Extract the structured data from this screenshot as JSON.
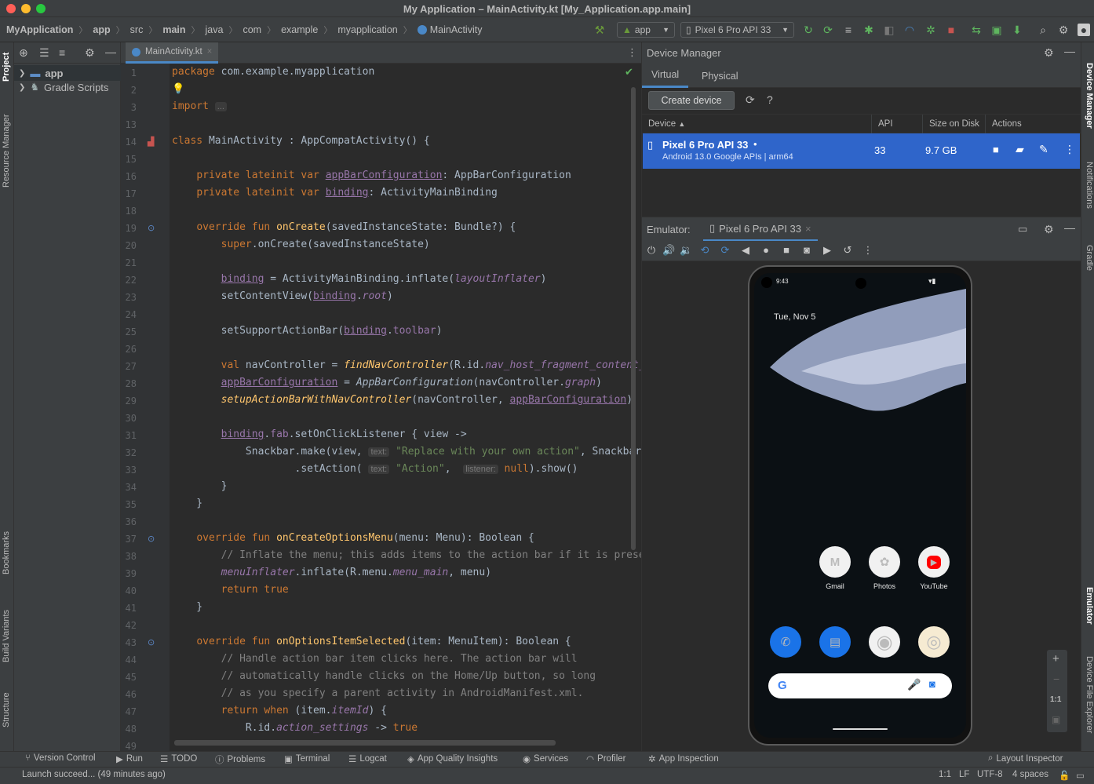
{
  "window": {
    "title": "My Application – MainActivity.kt [My_Application.app.main]"
  },
  "breadcrumb": [
    "MyApplication",
    "app",
    "src",
    "main",
    "java",
    "com",
    "example",
    "myapplication",
    "MainActivity"
  ],
  "toolbar": {
    "run_config": "app",
    "device": "Pixel 6 Pro API 33"
  },
  "left_strip": {
    "project": "Project",
    "resource_manager": "Resource Manager",
    "bookmarks": "Bookmarks",
    "build_variants": "Build Variants",
    "structure": "Structure"
  },
  "project_tree": [
    {
      "label": "app"
    },
    {
      "label": "Gradle Scripts"
    }
  ],
  "editor": {
    "tab": "MainActivity.kt",
    "line_numbers": [
      "1",
      "2",
      "3",
      "13",
      "14",
      "15",
      "16",
      "17",
      "18",
      "19",
      "20",
      "21",
      "22",
      "23",
      "24",
      "25",
      "26",
      "27",
      "28",
      "29",
      "30",
      "31",
      "32",
      "33",
      "34",
      "35",
      "36",
      "37",
      "38",
      "39",
      "40",
      "41",
      "42",
      "43",
      "44",
      "45",
      "46",
      "47",
      "48",
      "49"
    ]
  },
  "device_manager": {
    "title": "Device Manager",
    "tabs": [
      "Virtual",
      "Physical"
    ],
    "create_button": "Create device",
    "help": "?",
    "columns": [
      "Device",
      "API",
      "Size on Disk",
      "Actions"
    ],
    "device": {
      "name": "Pixel 6 Pro API 33",
      "dot": "•",
      "subtitle": "Android 13.0 Google APIs | arm64",
      "api": "33",
      "size": "9.7 GB"
    }
  },
  "emulator": {
    "label": "Emulator:",
    "tab": "Pixel 6 Pro API 33",
    "phone": {
      "time": "9:43",
      "date": "Tue, Nov 5",
      "row1": [
        {
          "name": "Gmail",
          "glyph": "M",
          "color": "#d93025"
        },
        {
          "name": "Photos",
          "glyph": "✿",
          "color": "#fbbc04"
        },
        {
          "name": "YouTube",
          "glyph": "▶",
          "color": "#ffffff"
        }
      ],
      "row2": [
        {
          "glyph": "✆",
          "color": "#ffffff"
        },
        {
          "glyph": "▤",
          "color": "#ffffff"
        },
        {
          "glyph": "◉",
          "color": "#4285f4"
        },
        {
          "glyph": "◎",
          "color": "#e37400"
        }
      ],
      "search_g": "G",
      "zoom_plus": "+",
      "zoom_minus": "−",
      "zoom_ratio": "1:1"
    }
  },
  "right_strip": {
    "device_manager": "Device Manager",
    "notifications": "Notifications",
    "gradle": "Gradle",
    "emulator": "Emulator",
    "device_file_explorer": "Device File Explorer"
  },
  "bottom_tools": [
    "Version Control",
    "Run",
    "TODO",
    "Problems",
    "Terminal",
    "Logcat",
    "App Quality Insights",
    "Services",
    "Profiler",
    "App Inspection"
  ],
  "bottom_right_tool": "Layout Inspector",
  "status": {
    "message": "Launch succeed... (49 minutes ago)",
    "position": "1:1",
    "line_sep": "LF",
    "encoding": "UTF-8",
    "indent": "4 spaces"
  }
}
